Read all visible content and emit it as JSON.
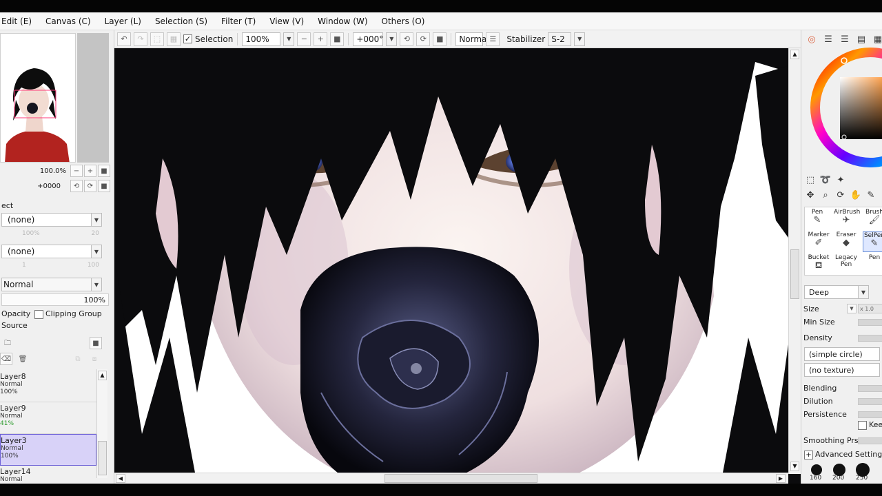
{
  "menu": {
    "items": [
      "Edit (E)",
      "Canvas (C)",
      "Layer (L)",
      "Selection (S)",
      "Filter (T)",
      "View (V)",
      "Window (W)",
      "Others (O)"
    ]
  },
  "toolbar": {
    "selection_label": "Selection",
    "selection_checked": true,
    "zoom_value": "100%",
    "rotation_value": "+000°",
    "blend_mode": "Normal",
    "stabilizer_label": "Stabilizer",
    "stabilizer_value": "S-2"
  },
  "navigator": {
    "zoom": "100.0%",
    "angle": "+0000"
  },
  "left_panel": {
    "section_label": "ect",
    "paper_texture": "(none)",
    "paper_scale_disabled": "100%",
    "paper_strength_disabled": "20",
    "paper_effect": "(none)",
    "paper_effect_v1": "1",
    "paper_effect_v2": "100",
    "blend_mode": "Normal",
    "opacity_value": "100%",
    "opacity_label": "Opacity",
    "clipping_group_label": "Clipping Group",
    "source_label": "Source"
  },
  "layers": [
    {
      "name": "Layer8",
      "mode": "Normal",
      "opacity": "100%",
      "selected": false
    },
    {
      "name": "Layer9",
      "mode": "Normal",
      "opacity": "41%",
      "selected": false
    },
    {
      "name": "Layer3",
      "mode": "Normal",
      "opacity": "100%",
      "selected": true
    },
    {
      "name": "Layer14",
      "mode": "Normal",
      "opacity": "100%",
      "selected": false
    }
  ],
  "brushes": {
    "items": [
      {
        "label": "Pen"
      },
      {
        "label": "AirBrush"
      },
      {
        "label": "Brush"
      },
      {
        "label": "Marker"
      },
      {
        "label": "Eraser"
      },
      {
        "label": "SelPen"
      },
      {
        "label": "Bucket"
      },
      {
        "label": "Legacy Pen"
      },
      {
        "label": "Pen"
      }
    ]
  },
  "brush_settings": {
    "mode": "Deep",
    "size_label": "Size",
    "size_multiplier": "x 1.0",
    "min_size_label": "Min Size",
    "density_label": "Density",
    "shape": "(simple circle)",
    "texture": "(no texture)",
    "blending_label": "Blending",
    "dilution_label": "Dilution",
    "persistence_label": "Persistence",
    "keep_label": "Kee",
    "smoothing_label": "Smoothing Prs",
    "advanced_label": "Advanced Settings",
    "presets": [
      "160",
      "200",
      "250"
    ]
  },
  "colors": {
    "selected_layer_bg": "#d8d2f8",
    "selected_layer_border": "#6b5fd6",
    "color_square_hue": "#ff7a00"
  }
}
